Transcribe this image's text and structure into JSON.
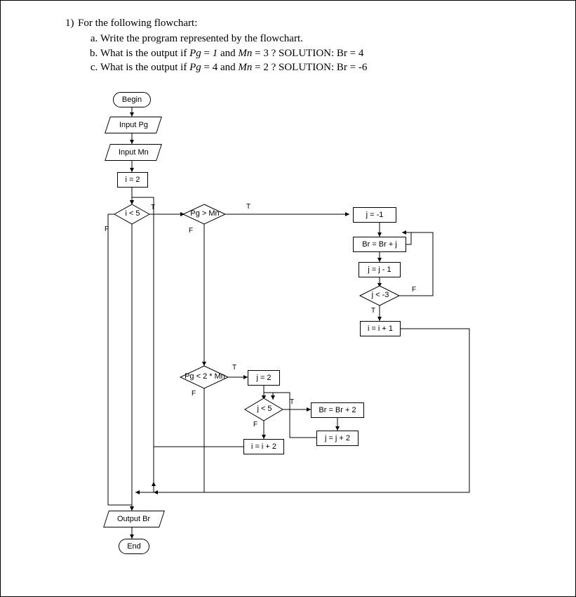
{
  "question": {
    "number": "1)",
    "stem": "For the following flowchart:",
    "parts": [
      {
        "text": "Write the program represented by the flowchart."
      },
      {
        "text_html": "What is the output if <span class='italic'>Pg</span> = <span class='italic'>1</span> and <span class='italic'>Mn</span> = 3 ?  SOLUTION:  Br = 4"
      },
      {
        "text_html": "What is the output if <span class='italic'>Pg</span> = 4 and <span class='italic'>Mn</span> = 2 ?  SOLUTION:  Br = -6"
      }
    ]
  },
  "flow": {
    "begin": "Begin",
    "input_pg": "Input Pg",
    "input_mn": "Input Mn",
    "i_init": "i = 2",
    "dec_i5": "i < 5",
    "dec_pg_mn": "Pg > Mn",
    "j_neg1": "j = -1",
    "br_brj": "Br = Br + j",
    "j_jm1": "j = j - 1",
    "dec_j_m3": "j < -3",
    "i_ip1": "i = i + 1",
    "dec_pg_2mn": "Pg < 2 * Mn",
    "j_2": "j = 2",
    "dec_j5": "j < 5",
    "br_br2": "Br = Br + 2",
    "j_jp2": "j = j + 2",
    "i_ip2": "i = i + 2",
    "output_br": "Output Br",
    "end": "End",
    "T": "T",
    "F": "F"
  }
}
